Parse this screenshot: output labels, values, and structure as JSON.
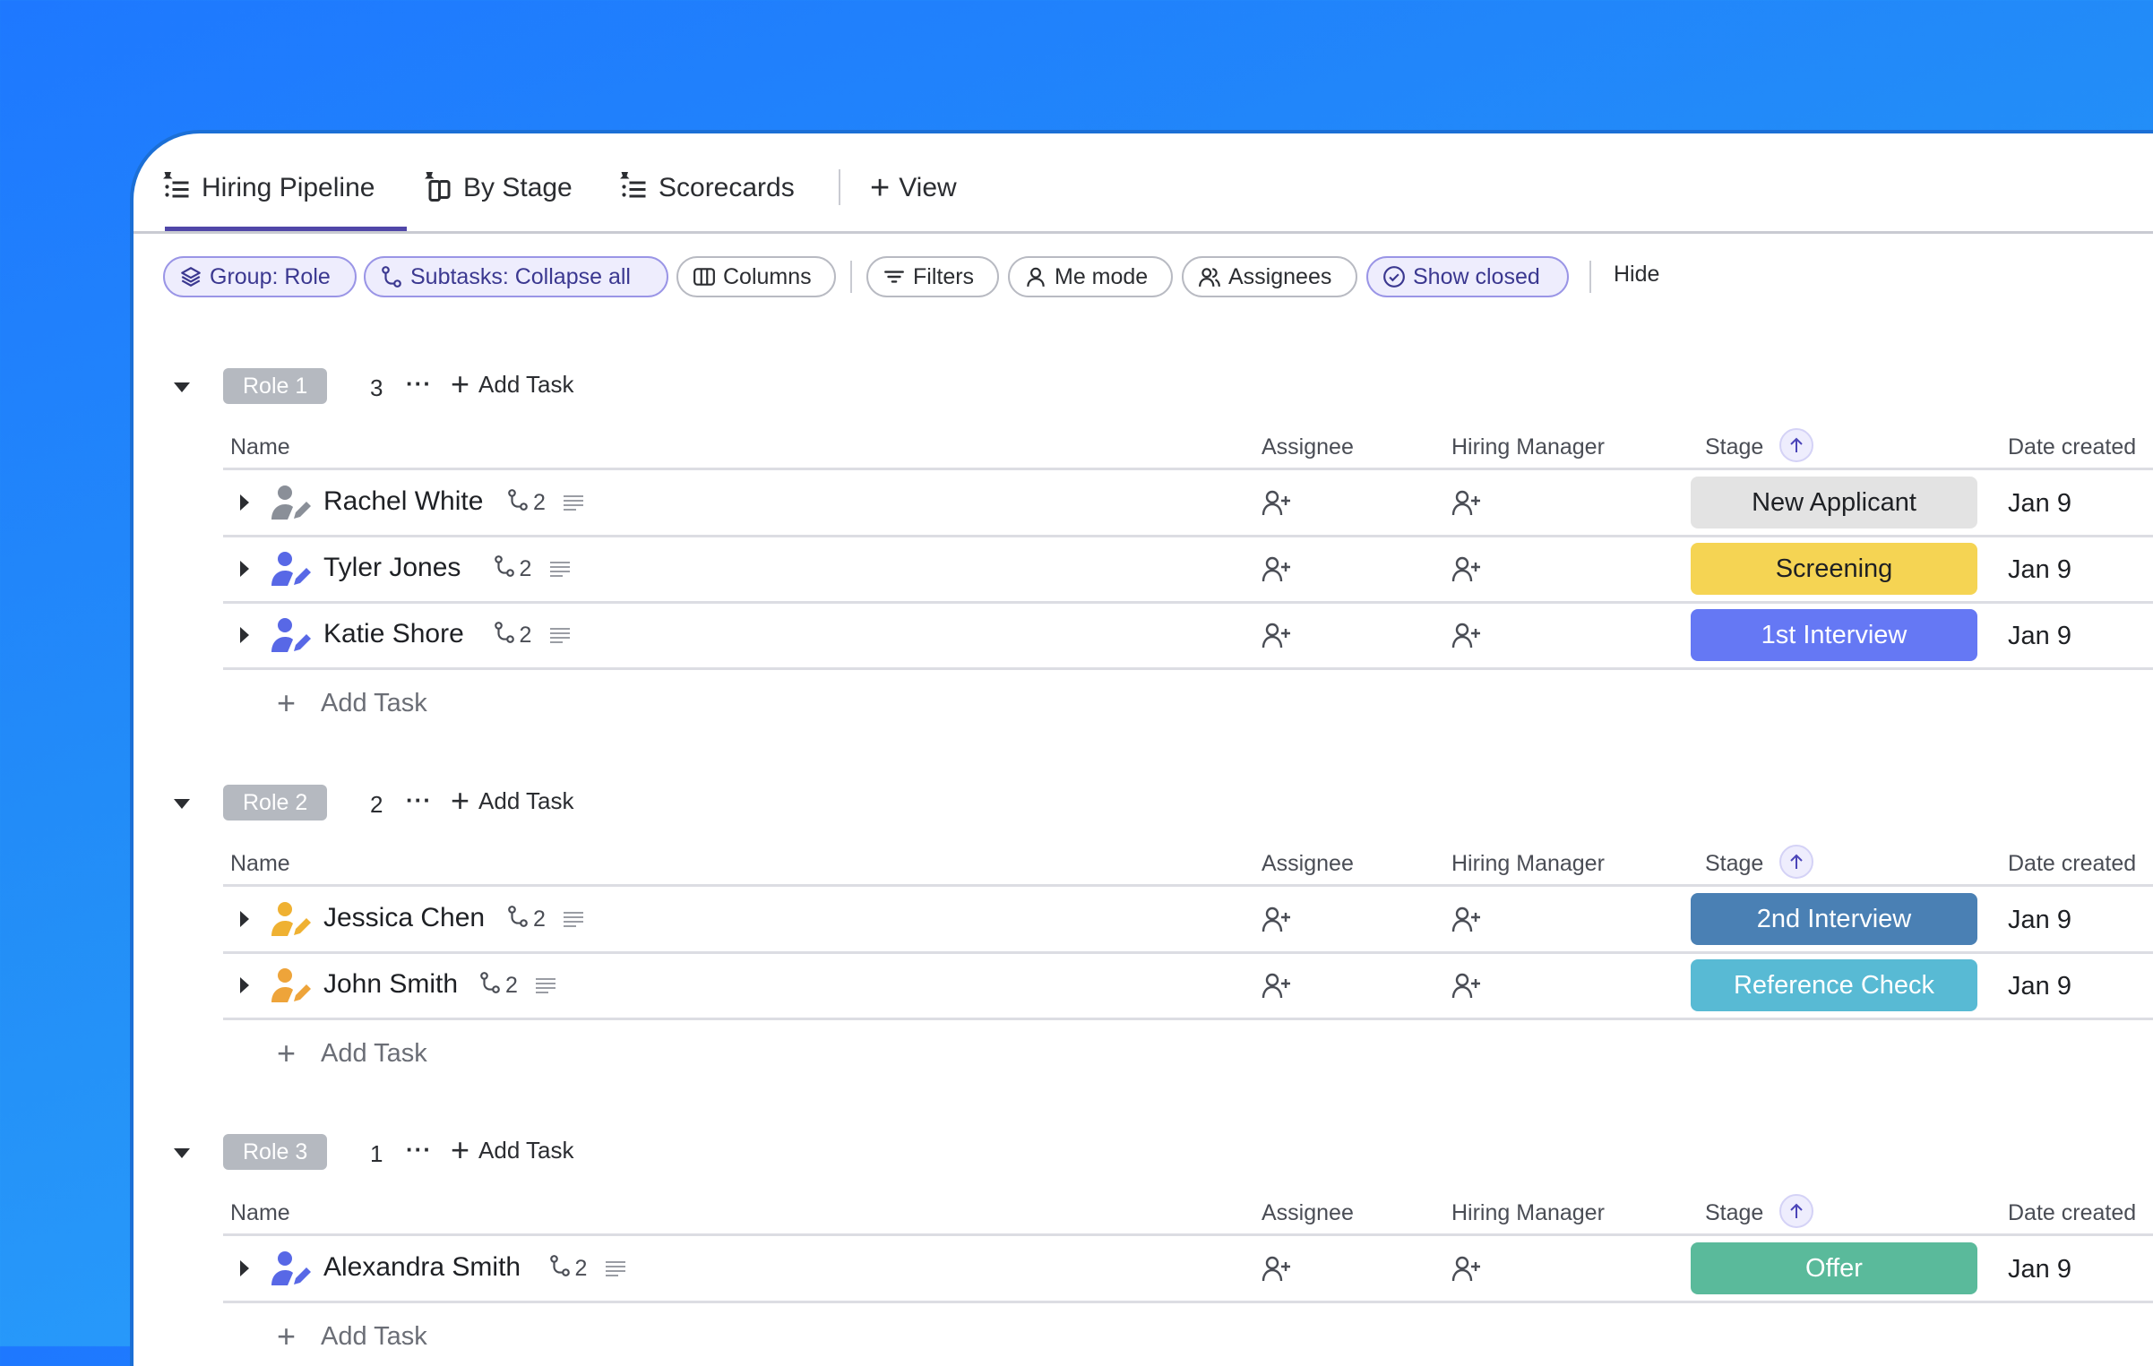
{
  "tabs": [
    {
      "label": "Hiring Pipeline",
      "icon": "pinned-list-icon",
      "active": true
    },
    {
      "label": "By Stage",
      "icon": "pinned-board-icon",
      "active": false
    },
    {
      "label": "Scorecards",
      "icon": "pinned-list-icon",
      "active": false
    }
  ],
  "add_view": {
    "label": "View",
    "icon": "plus-icon"
  },
  "toolbar": {
    "group": {
      "label": "Group: Role",
      "icon": "layers-icon",
      "active": true
    },
    "subtasks": {
      "label": "Subtasks: Collapse all",
      "icon": "subtask-icon",
      "active": true
    },
    "columns": {
      "label": "Columns",
      "icon": "columns-icon",
      "active": false
    },
    "filters": {
      "label": "Filters",
      "icon": "filter-icon",
      "active": false
    },
    "me_mode": {
      "label": "Me mode",
      "icon": "user-icon",
      "active": false
    },
    "assignees": {
      "label": "Assignees",
      "icon": "users-icon",
      "active": false
    },
    "show_closed": {
      "label": "Show closed",
      "icon": "check-circle-icon",
      "active": true
    },
    "hide": {
      "label": "Hide"
    }
  },
  "columns": {
    "name": "Name",
    "assignee": "Assignee",
    "hiring_manager": "Hiring Manager",
    "stage": "Stage",
    "date_created": "Date created",
    "sort": "ascending"
  },
  "add_task_label": "Add Task",
  "stage_colors": {
    "New Applicant": {
      "bg": "#e3e3e3",
      "fg": "#1e2024"
    },
    "Screening": {
      "bg": "#f5d453",
      "fg": "#1e2024"
    },
    "1st Interview": {
      "bg": "#6578f4",
      "fg": "#ffffff"
    },
    "2nd Interview": {
      "bg": "#4a80b4",
      "fg": "#ffffff"
    },
    "Reference Check": {
      "bg": "#58bad4",
      "fg": "#ffffff"
    },
    "Offer": {
      "bg": "#5aba9b",
      "fg": "#ffffff"
    }
  },
  "groups": [
    {
      "label": "Role 1",
      "count": "3",
      "tasks": [
        {
          "name": "Rachel White",
          "subtasks": "2",
          "avatar_color": "#8a8f98",
          "stage": "New Applicant",
          "date": "Jan 9"
        },
        {
          "name": "Tyler Jones",
          "subtasks": "2",
          "avatar_color": "#5868e6",
          "stage": "Screening",
          "date": "Jan 9"
        },
        {
          "name": "Katie Shore",
          "subtasks": "2",
          "avatar_color": "#5868e6",
          "stage": "1st Interview",
          "date": "Jan 9"
        }
      ]
    },
    {
      "label": "Role 2",
      "count": "2",
      "tasks": [
        {
          "name": "Jessica Chen",
          "subtasks": "2",
          "avatar_color": "#efb132",
          "stage": "2nd Interview",
          "date": "Jan 9"
        },
        {
          "name": "John Smith",
          "subtasks": "2",
          "avatar_color": "#eea43a",
          "stage": "Reference Check",
          "date": "Jan 9"
        }
      ]
    },
    {
      "label": "Role 3",
      "count": "1",
      "tasks": [
        {
          "name": "Alexandra Smith",
          "subtasks": "2",
          "avatar_color": "#5868e6",
          "stage": "Offer",
          "date": "Jan 9"
        }
      ]
    }
  ],
  "colors": {
    "accent": "#5046a8",
    "background_top": "#1e78ff",
    "background_bottom": "#2ea9ff"
  }
}
